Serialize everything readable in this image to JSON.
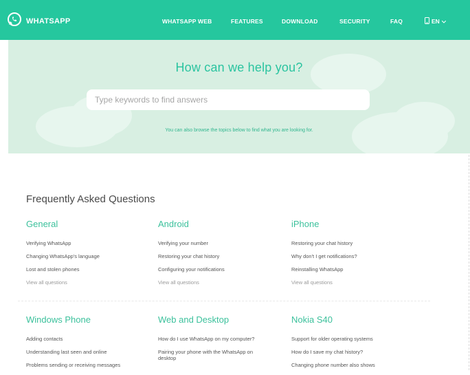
{
  "header": {
    "brand": "WHATSAPP",
    "nav": [
      "WHATSAPP WEB",
      "FEATURES",
      "DOWNLOAD",
      "SECURITY",
      "FAQ"
    ],
    "language": "EN"
  },
  "hero": {
    "title": "How can we help you?",
    "search_placeholder": "Type keywords to find answers",
    "hint": "You can also browse the topics below to find what you are looking for."
  },
  "faq": {
    "title": "Frequently Asked Questions",
    "sections": [
      {
        "title": "General",
        "links": [
          "Verifying WhatsApp",
          "Changing WhatsApp's language",
          "Lost and stolen phones"
        ],
        "more": "View all questions"
      },
      {
        "title": "Android",
        "links": [
          "Verifying your number",
          "Restoring your chat history",
          "Configuring your notifications"
        ],
        "more": "View all questions"
      },
      {
        "title": "iPhone",
        "links": [
          "Restoring your chat history",
          "Why don't I get notifications?",
          "Reinstalling WhatsApp"
        ],
        "more": "View all questions"
      },
      {
        "title": "Windows Phone",
        "links": [
          "Adding contacts",
          "Understanding last seen and online",
          "Problems sending or receiving messages"
        ]
      },
      {
        "title": "Web and Desktop",
        "links": [
          "How do I use WhatsApp on my computer?",
          "Pairing your phone with the WhatsApp on desktop"
        ]
      },
      {
        "title": "Nokia S40",
        "links": [
          "Support for older operating systems",
          "How do I save my chat history?",
          "Changing phone number also shows"
        ]
      }
    ]
  },
  "colors": {
    "brand": "#25c79e",
    "hero_bg": "#d8efe2",
    "accent_text": "#2bc4a0"
  }
}
